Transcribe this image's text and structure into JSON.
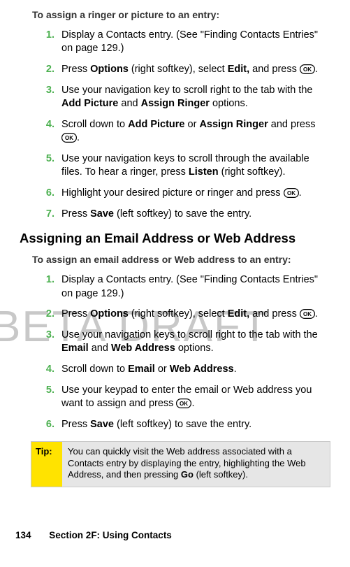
{
  "watermark": "BETA DRAFT",
  "section1": {
    "intro": "To assign a ringer or picture to an entry:",
    "steps": [
      {
        "num": "1.",
        "html": "Display a Contacts entry. (See \"Finding Contacts Entries\" on page 129.)"
      },
      {
        "num": "2.",
        "html": "Press <b>Options</b> (right softkey), select <b>Edit,</b> and press <span class='ok-key'>__OK__</span>."
      },
      {
        "num": "3.",
        "html": "Use your navigation key to scroll right to the tab with the <b>Add Picture</b> and <b>Assign Ringer</b> options."
      },
      {
        "num": "4.",
        "html": "Scroll down to <b>Add Picture</b> or <b>Assign Ringer</b> and press <span class='ok-key'>__OK__</span>."
      },
      {
        "num": "5.",
        "html": "Use your navigation keys to scroll through the available files. To hear a ringer, press <b>Listen</b> (right softkey)."
      },
      {
        "num": "6.",
        "html": "Highlight your desired picture or ringer and press <span class='ok-key'>__OK__</span>."
      },
      {
        "num": "7.",
        "html": "Press <b>Save</b> (left softkey) to save the entry."
      }
    ]
  },
  "heading2": "Assigning an Email Address or Web Address",
  "section2": {
    "intro": "To assign an email address or Web address to an entry:",
    "steps": [
      {
        "num": "1.",
        "html": "Display a Contacts entry. (See \"Finding Contacts Entries\" on page 129.)"
      },
      {
        "num": "2.",
        "html": "Press <b>Options</b> (right softkey), select <b>Edit,</b> and press <span class='ok-key'>__OK__</span>."
      },
      {
        "num": "3.",
        "html": "Use your navigation keys to scroll right to the tab with the <b>Email</b> and <b>Web Address</b> options."
      },
      {
        "num": "4.",
        "html": "Scroll down to <b>Email</b> or <b>Web Address</b>."
      },
      {
        "num": "5.",
        "html": "Use your keypad to enter the email or Web address you want to assign and press <span class='ok-key'>__OK__</span>."
      },
      {
        "num": "6.",
        "html": "Press <b>Save</b> (left softkey) to save the entry."
      }
    ]
  },
  "tip": {
    "label": "Tip:",
    "html": "You can quickly visit the Web address associated with a Contacts entry by displaying the entry, highlighting the Web Address, and then pressing <b>Go</b> (left softkey)."
  },
  "footer": {
    "page": "134",
    "section": "Section 2F: Using Contacts"
  },
  "icons": {
    "ok_key": "ok-key-icon"
  }
}
